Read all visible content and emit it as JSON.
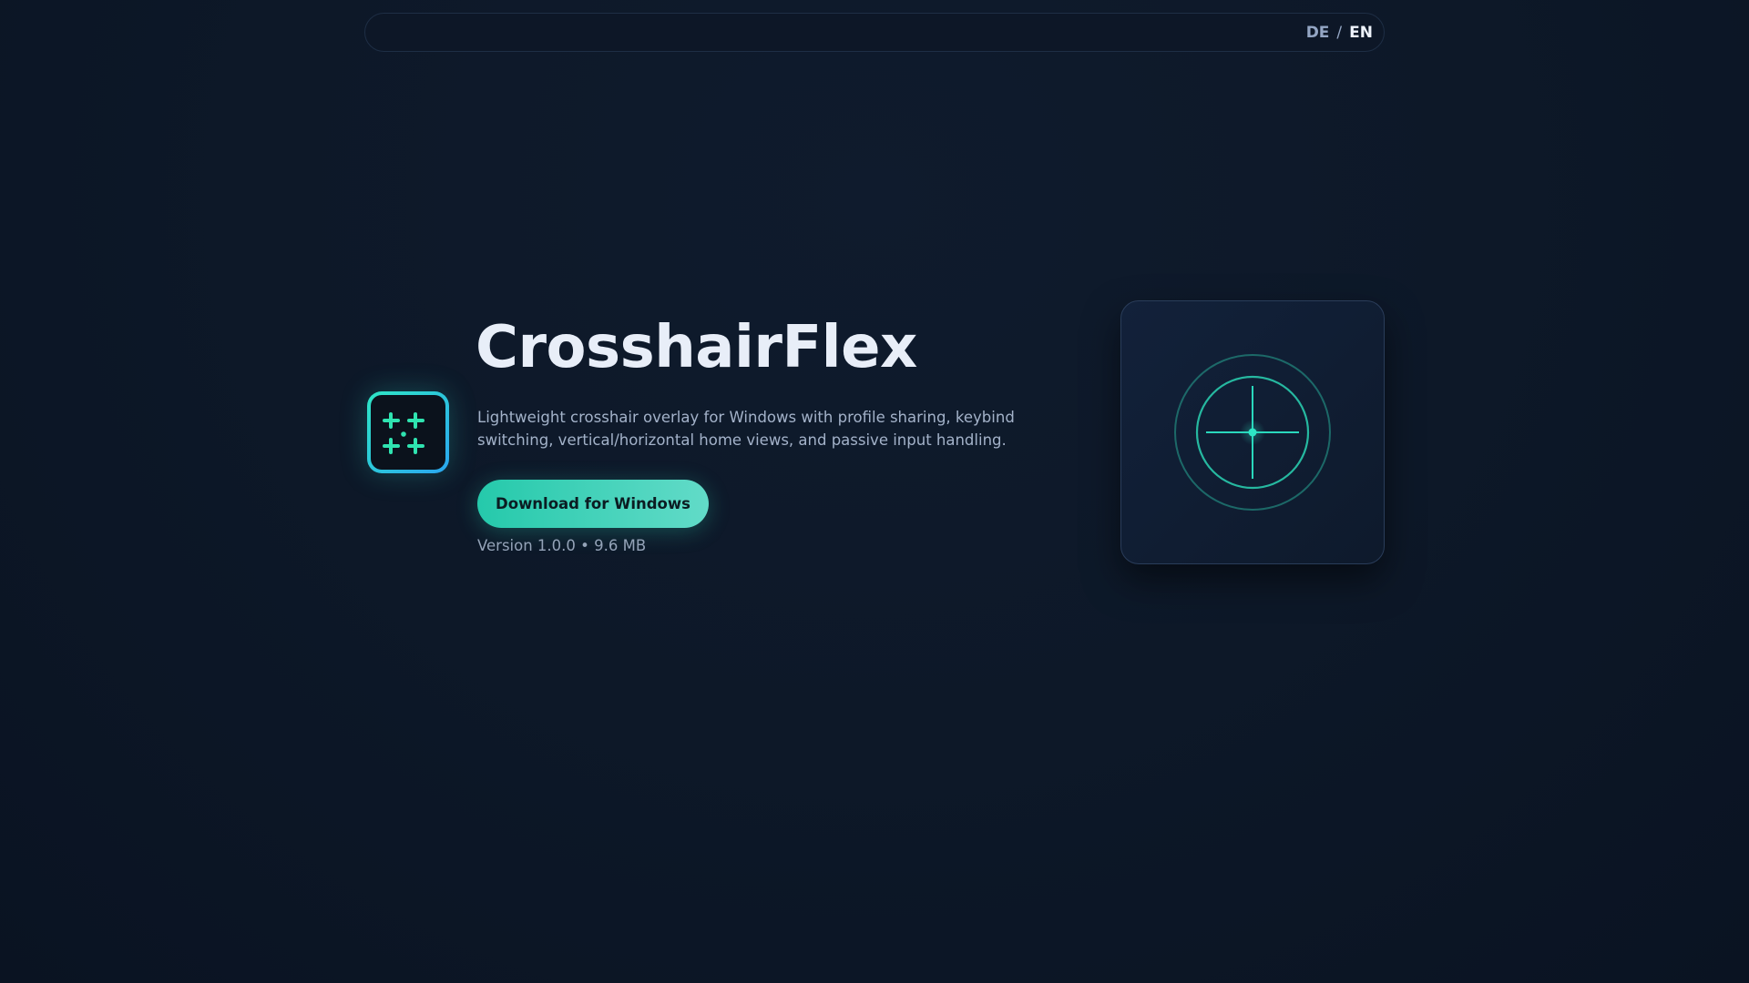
{
  "nav": {
    "lang_de": "DE",
    "lang_sep": "/",
    "lang_en": "EN"
  },
  "hero": {
    "title": "CrosshairFlex",
    "description": "Lightweight crosshair overlay for Windows with profile sharing, keybind switching, vertical/horizontal home views, and passive input handling.",
    "download_label": "Download for Windows",
    "version_info": "Version 1.0.0 • 9.6 MB"
  },
  "colors": {
    "accent": "#2ee6c5",
    "accent2": "#2aa6f0",
    "bg": "#0d1828"
  }
}
